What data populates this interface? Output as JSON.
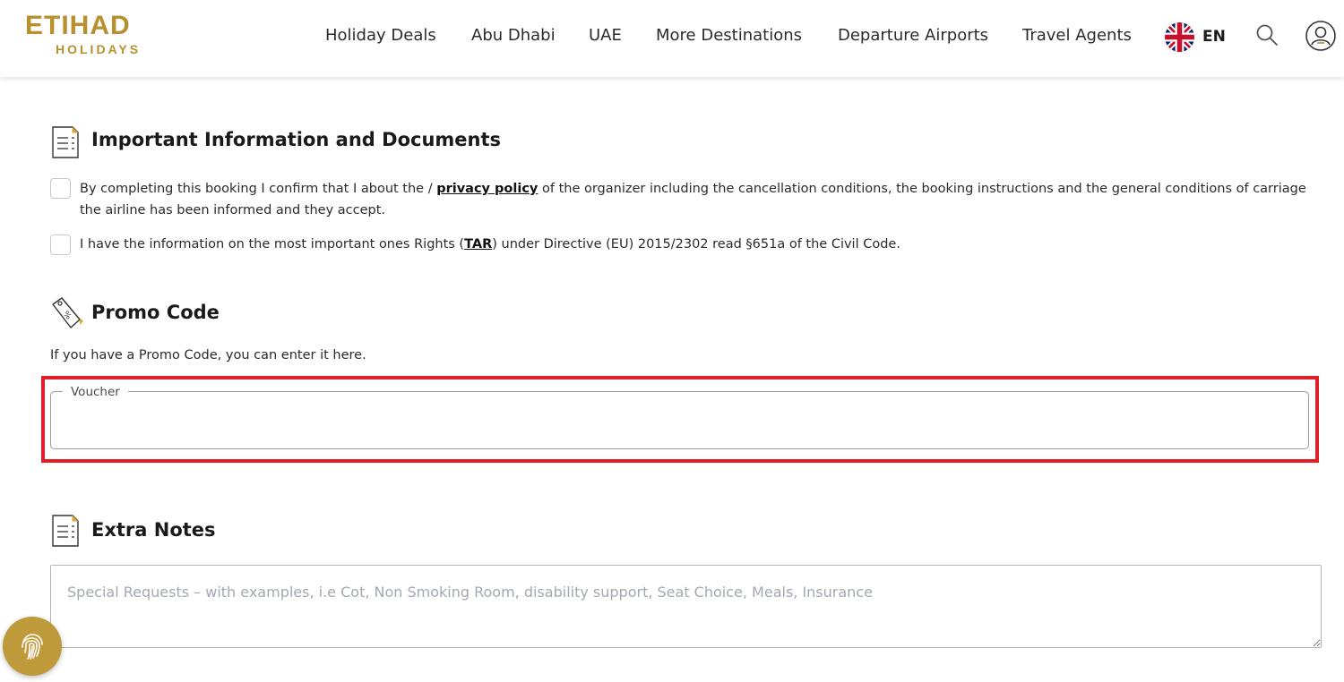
{
  "brand": {
    "logo_top": "ETIHAD",
    "logo_bottom": "HOLIDAYS",
    "accent_color": "#b8902e"
  },
  "nav": {
    "items": [
      {
        "label": "Holiday Deals"
      },
      {
        "label": "Abu Dhabi"
      },
      {
        "label": "UAE"
      },
      {
        "label": "More Destinations"
      },
      {
        "label": "Departure Airports"
      },
      {
        "label": "Travel Agents"
      }
    ],
    "language": "EN",
    "icons": [
      "uk-flag-icon",
      "search-icon",
      "user-account-icon"
    ]
  },
  "important": {
    "title": "Important Information and Documents",
    "check1_pre": "By completing this booking I confirm that I about the / ",
    "check1_link": "privacy policy",
    "check1_post": " of the organizer including the cancellation conditions, the booking instructions and the general conditions of carriage the airline has been informed and they accept.",
    "check2_pre": "I have the information on the most important ones Rights (",
    "check2_link": "TAR",
    "check2_post": ") under Directive (EU) 2015/2302 read §651a of the Civil Code."
  },
  "promo": {
    "title": "Promo Code",
    "description": "If you have a Promo Code, you can enter it here.",
    "voucher_label": "Voucher",
    "voucher_value": "",
    "highlight_color": "#e01e26"
  },
  "notes": {
    "title": "Extra Notes",
    "placeholder": "Special Requests – with examples, i.e Cot, Non Smoking Room, disability support, Seat Choice, Meals, Insurance"
  },
  "floating": {
    "icon": "fingerprint-icon"
  }
}
